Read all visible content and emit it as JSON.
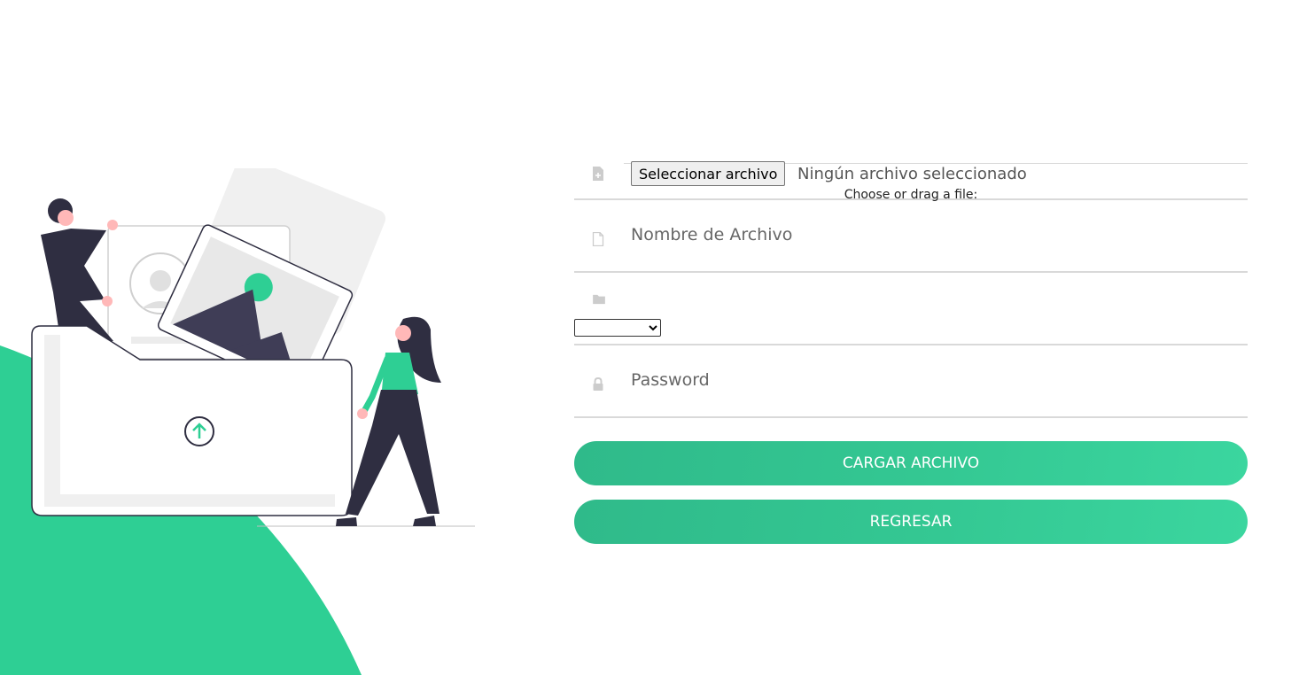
{
  "form": {
    "file_button_label": "Seleccionar archivo",
    "file_status": "Ningún archivo seleccionado",
    "file_caption": "Choose or drag a file:",
    "filename_placeholder": "Nombre de Archivo",
    "folder_select_value": "",
    "password_placeholder": "Password",
    "submit_label": "CARGAR ARCHIVO",
    "back_label": "REGRESAR"
  },
  "icons": {
    "file_upload": "file-plus-icon",
    "file_name": "file-icon",
    "folder": "folder-icon",
    "password": "lock-icon"
  },
  "colors": {
    "accent_green": "#2ecf94",
    "button_green": "#34c893",
    "illustration_dark": "#2f2e41",
    "divider": "#d9d9d9"
  }
}
